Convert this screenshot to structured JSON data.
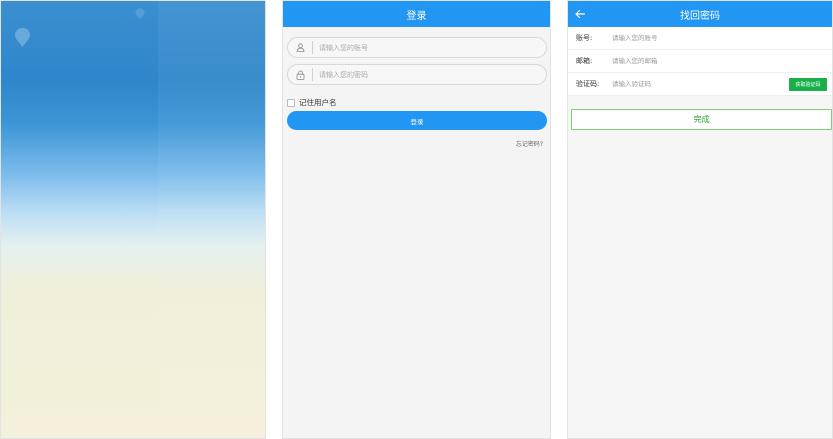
{
  "splash": {
    "icons": [
      "balloon-icon",
      "balloon-icon"
    ]
  },
  "login": {
    "title": "登录",
    "username": {
      "placeholder": "请输入您的账号",
      "icon": "user-icon"
    },
    "password": {
      "placeholder": "请输入您的密码",
      "icon": "lock-icon"
    },
    "remember_label": "记住用户名",
    "login_button": "登录",
    "forgot_link": "忘记密码?"
  },
  "recover": {
    "title": "找回密码",
    "back_icon": "arrow-left-icon",
    "fields": [
      {
        "label": "账号:",
        "placeholder": "请输入您的账号"
      },
      {
        "label": "邮箱:",
        "placeholder": "请输入您的邮箱"
      },
      {
        "label": "验证码:",
        "placeholder": "请输入验证码"
      }
    ],
    "get_code_button": "获取验证码",
    "done_button": "完成"
  },
  "colors": {
    "primary": "#2196f3",
    "success": "#19b04a",
    "done_text": "#2da12b"
  }
}
